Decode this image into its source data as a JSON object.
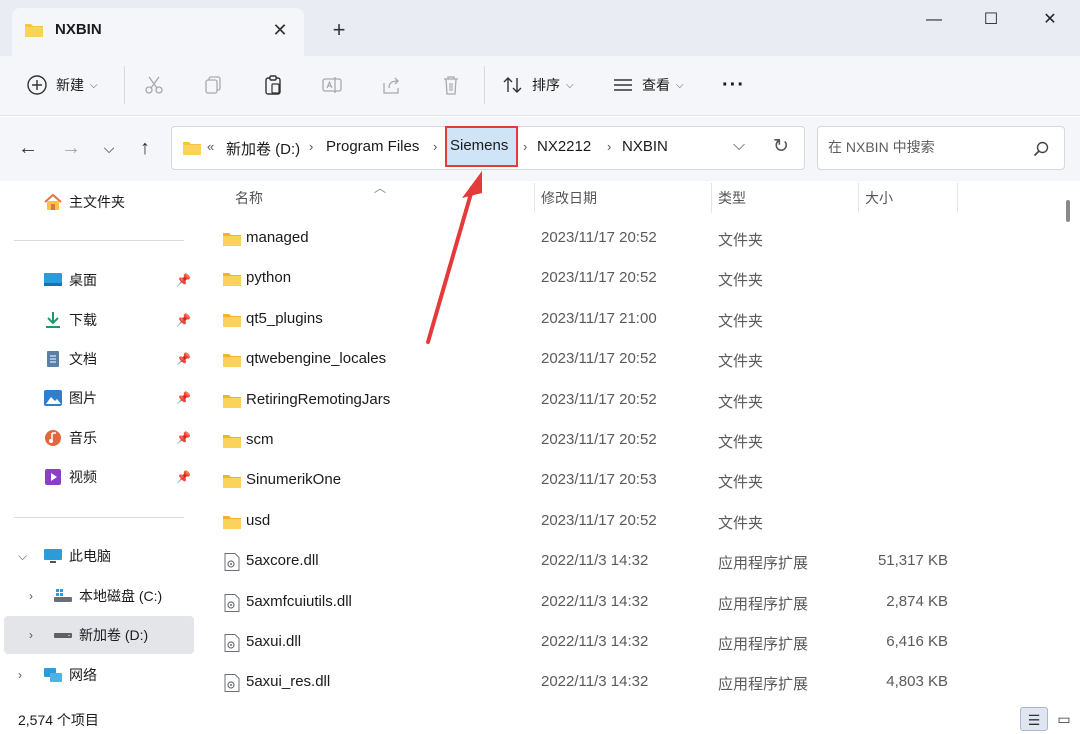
{
  "window": {
    "tab_title": "NXBIN",
    "tab_close": "✕",
    "tab_add": "+",
    "minimize": "—",
    "maximize": "☐",
    "close": "✕"
  },
  "toolbar": {
    "new_label": "新建",
    "sort_label": "排序",
    "view_label": "查看",
    "more_label": "···"
  },
  "address": {
    "overflow": "«",
    "crumbs": [
      "新加卷 (D:)",
      "Program Files",
      "Siemens",
      "NX2212",
      "NXBIN"
    ],
    "highlighted_crumb": "Siemens",
    "search_placeholder": "在 NXBIN 中搜索"
  },
  "sidebar": {
    "home": "主文件夹",
    "quick_access": [
      "桌面",
      "下载",
      "文档",
      "图片",
      "音乐",
      "视频"
    ],
    "this_pc": "此电脑",
    "drives": [
      "本地磁盘 (C:)",
      "新加卷 (D:)"
    ],
    "network": "网络"
  },
  "columns": {
    "name": "名称",
    "date": "修改日期",
    "type": "类型",
    "size": "大小"
  },
  "files": [
    {
      "name": "managed",
      "date": "2023/11/17 20:52",
      "type": "文件夹",
      "size": "",
      "kind": "folder"
    },
    {
      "name": "python",
      "date": "2023/11/17 20:52",
      "type": "文件夹",
      "size": "",
      "kind": "folder"
    },
    {
      "name": "qt5_plugins",
      "date": "2023/11/17 21:00",
      "type": "文件夹",
      "size": "",
      "kind": "folder"
    },
    {
      "name": "qtwebengine_locales",
      "date": "2023/11/17 20:52",
      "type": "文件夹",
      "size": "",
      "kind": "folder"
    },
    {
      "name": "RetiringRemotingJars",
      "date": "2023/11/17 20:52",
      "type": "文件夹",
      "size": "",
      "kind": "folder"
    },
    {
      "name": "scm",
      "date": "2023/11/17 20:52",
      "type": "文件夹",
      "size": "",
      "kind": "folder"
    },
    {
      "name": "SinumerikOne",
      "date": "2023/11/17 20:53",
      "type": "文件夹",
      "size": "",
      "kind": "folder"
    },
    {
      "name": "usd",
      "date": "2023/11/17 20:52",
      "type": "文件夹",
      "size": "",
      "kind": "folder"
    },
    {
      "name": "5axcore.dll",
      "date": "2022/11/3 14:32",
      "type": "应用程序扩展",
      "size": "51,317 KB",
      "kind": "dll"
    },
    {
      "name": "5axmfcuiutils.dll",
      "date": "2022/11/3 14:32",
      "type": "应用程序扩展",
      "size": "2,874 KB",
      "kind": "dll"
    },
    {
      "name": "5axui.dll",
      "date": "2022/11/3 14:32",
      "type": "应用程序扩展",
      "size": "6,416 KB",
      "kind": "dll"
    },
    {
      "name": "5axui_res.dll",
      "date": "2022/11/3 14:32",
      "type": "应用程序扩展",
      "size": "4,803 KB",
      "kind": "dll"
    }
  ],
  "status": {
    "item_count": "2,574 个项目"
  },
  "colors": {
    "folder": "#f7c543",
    "accent": "#0067c0",
    "annotation_red": "#e53a3a"
  }
}
